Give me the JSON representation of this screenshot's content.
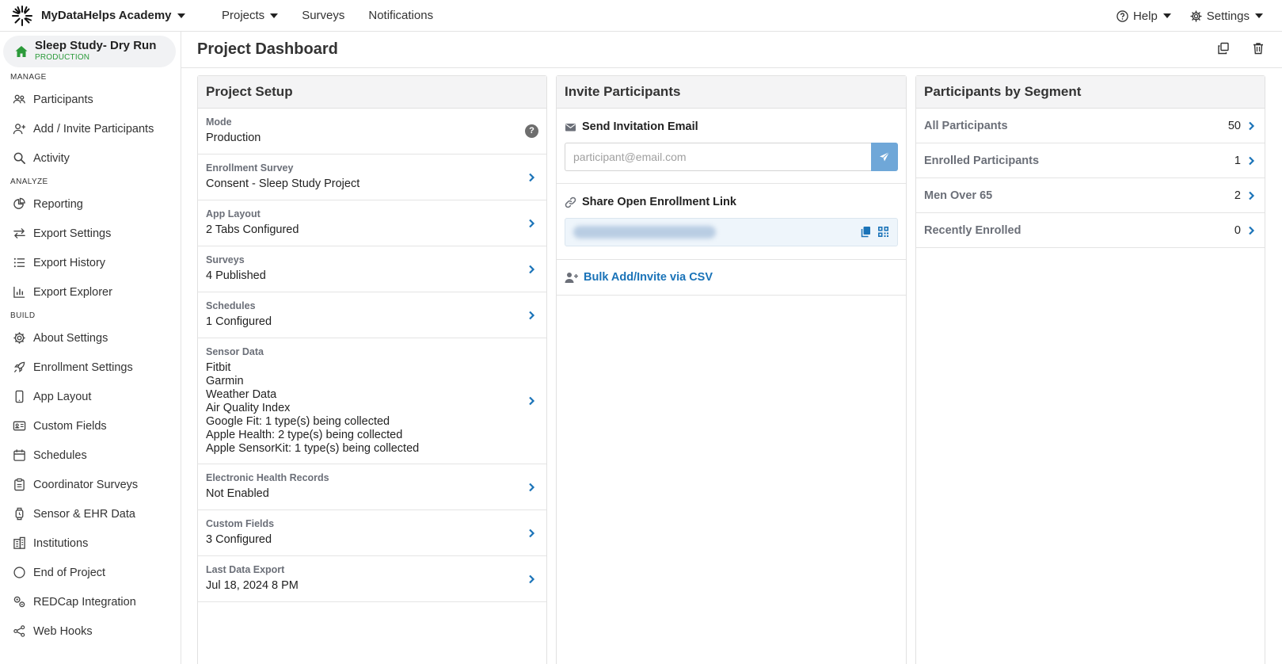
{
  "topbar": {
    "brand": "MyDataHelps Academy",
    "nav": [
      "Projects",
      "Surveys",
      "Notifications"
    ],
    "help": "Help",
    "settings": "Settings"
  },
  "sidebar": {
    "project_title": "Sleep Study- Dry Run",
    "project_mode": "PRODUCTION",
    "sections": {
      "manage": "MANAGE",
      "analyze": "ANALYZE",
      "build": "BUILD"
    },
    "manage_items": [
      "Participants",
      "Add / Invite Participants",
      "Activity"
    ],
    "analyze_items": [
      "Reporting",
      "Export Settings",
      "Export History",
      "Export Explorer"
    ],
    "build_items": [
      "About Settings",
      "Enrollment Settings",
      "App Layout",
      "Custom Fields",
      "Schedules",
      "Coordinator Surveys",
      "Sensor & EHR Data",
      "Institutions",
      "End of Project",
      "REDCap Integration",
      "Web Hooks"
    ]
  },
  "main": {
    "page_title": "Project Dashboard",
    "setup": {
      "title": "Project Setup",
      "rows": [
        {
          "label": "Mode",
          "value": "Production"
        },
        {
          "label": "Enrollment Survey",
          "value": "Consent - Sleep Study Project"
        },
        {
          "label": "App Layout",
          "value": "2 Tabs Configured"
        },
        {
          "label": "Surveys",
          "value": "4 Published"
        },
        {
          "label": "Schedules",
          "value": "1 Configured"
        },
        {
          "label": "Sensor Data",
          "values": [
            "Fitbit",
            "Garmin",
            "Weather Data",
            "Air Quality Index",
            "Google Fit: 1 type(s) being collected",
            "Apple Health: 2 type(s) being collected",
            "Apple SensorKit: 1 type(s) being collected"
          ]
        },
        {
          "label": "Electronic Health Records",
          "value": "Not Enabled"
        },
        {
          "label": "Custom Fields",
          "value": "3 Configured"
        },
        {
          "label": "Last Data Export",
          "value": "Jul 18, 2024 8 PM"
        }
      ]
    },
    "invite": {
      "title": "Invite Participants",
      "send_title": "Send Invitation Email",
      "email_placeholder": "participant@email.com",
      "share_title": "Share Open Enrollment Link",
      "bulk_label": "Bulk Add/Invite via CSV"
    },
    "segments": {
      "title": "Participants by Segment",
      "rows": [
        {
          "name": "All Participants",
          "count": "50"
        },
        {
          "name": "Enrolled Participants",
          "count": "1"
        },
        {
          "name": "Men Over 65",
          "count": "2"
        },
        {
          "name": "Recently Enrolled",
          "count": "0"
        }
      ]
    }
  },
  "colors": {
    "accent": "#1a73b8",
    "send_button": "#6fa7d8",
    "production_green": "#2b9a3a",
    "card_header_bg": "#f4f4f5"
  }
}
